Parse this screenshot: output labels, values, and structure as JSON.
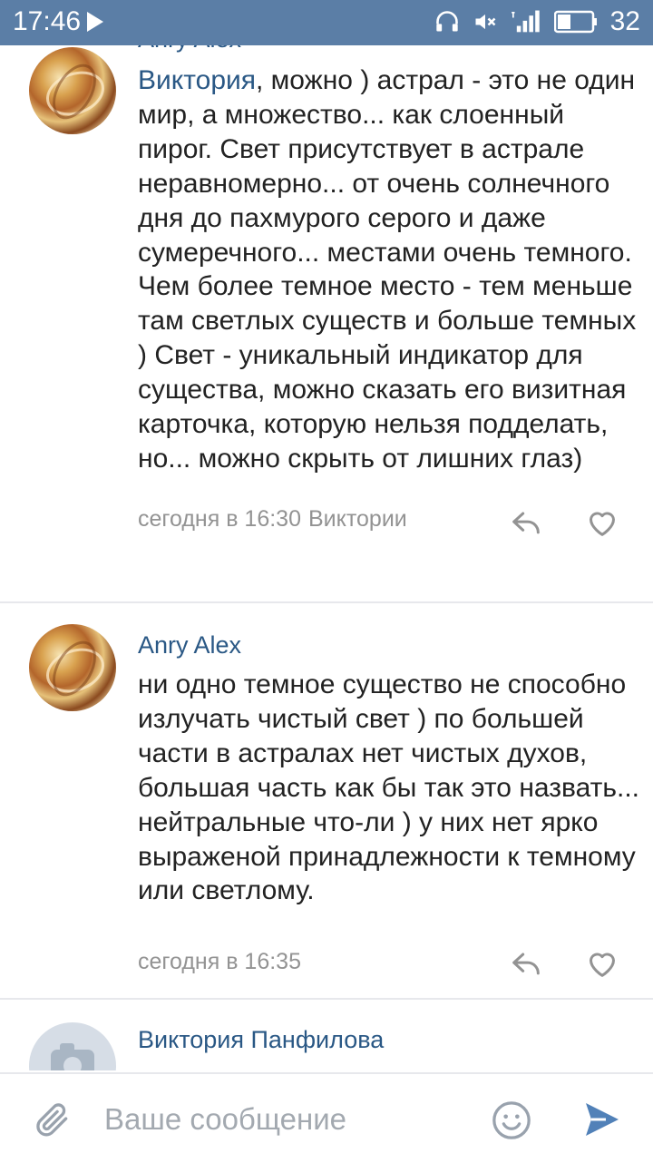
{
  "status_bar": {
    "time": "17:46",
    "battery": "32"
  },
  "comments": [
    {
      "author": "Anry Alex",
      "reply_to": "Виктория",
      "text": ", можно ) астрал - это не один мир, а множество... как слоенный пирог. Свет присутствует в астрале неравномерно... от очень солнечного дня до пахмурого серого и даже сумеречного... местами очень темного. Чем более темное место - тем меньше там светлых существ и больше темных ) Свет - уникальный индикатор для существа, можно сказать его визитная карточка, которую нельзя подделать, но... можно скрыть от лишних глаз)",
      "time": "сегодня в 16:30",
      "reply_target": "Виктории"
    },
    {
      "author": "Anry Alex",
      "text": "ни одно темное существо не способно излучать чистый свет ) по большей части в астралах нет чистых духов, большая часть как бы так это назвать... нейтральные что-ли ) у них нет ярко выраженой принадлежности к темному или светлому.",
      "time": "сегодня в 16:35"
    },
    {
      "author": "Виктория Панфилова"
    }
  ],
  "composer": {
    "placeholder": "Ваше сообщение"
  },
  "colors": {
    "status_bar": "#5b7ea6",
    "link": "#2a5885",
    "meta": "#939393",
    "send": "#5181b8"
  }
}
